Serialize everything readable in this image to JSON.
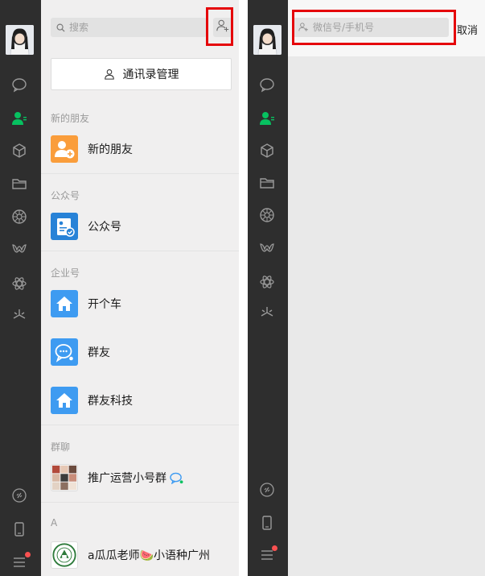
{
  "left": {
    "search": {
      "placeholder": "搜索"
    },
    "manage_button": "通讯录管理",
    "sections": {
      "new_friends": "新的朋友",
      "official": "公众号",
      "enterprise": "企业号",
      "groups": "群聊",
      "a_index": "A"
    },
    "items": {
      "new_friend": "新的朋友",
      "official_account": "公众号",
      "kaigeche": "开个车",
      "qunyou": "群友",
      "qunyou_tech": "群友科技",
      "promo_group": "推广运营小号群",
      "contact_a": "a瓜瓜老师🍉小语种广州"
    }
  },
  "right": {
    "add_search": {
      "placeholder": "微信号/手机号"
    },
    "cancel": "取消"
  },
  "colors": {
    "rail": "#2e2e2e",
    "active_green": "#07c160",
    "highlight_red": "#e5060a",
    "orange_icon": "#fa9d3b",
    "blue_icon": "#2782d7",
    "light_blue_icon": "#3e9bf1"
  },
  "icons": [
    "search-icon",
    "add-contact-icon",
    "chat-icon",
    "contacts-icon",
    "favorites-icon",
    "files-icon",
    "moments-icon",
    "channels-icon",
    "miniprogram-icon",
    "looking-icon",
    "link-icon",
    "phone-icon",
    "menu-icon"
  ]
}
